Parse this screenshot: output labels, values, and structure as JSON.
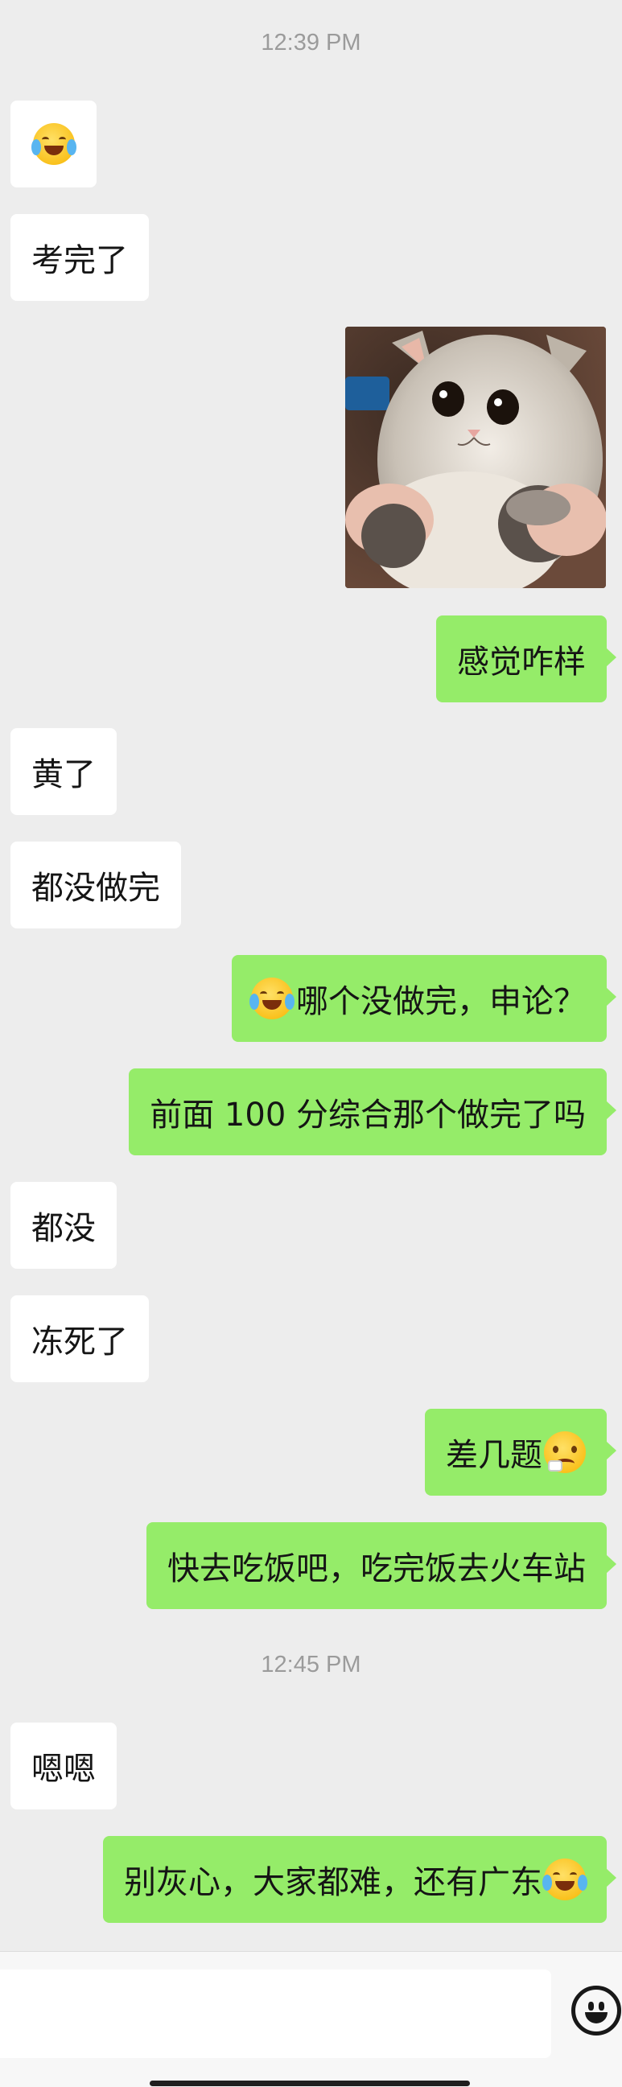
{
  "timestamps": [
    "12:39 PM",
    "12:45 PM"
  ],
  "messages": {
    "m1": "",
    "m2": "考完了",
    "m4": "感觉咋样",
    "m5": "黄了",
    "m6": "都没做完",
    "m7": "哪个没做完，申论？",
    "m8": "前面 100 分综合那个做完了吗",
    "m9": "都没",
    "m10": "冻死了",
    "m11": "差几题",
    "m12": "快去吃饭吧，吃完饭去火车站",
    "m13": "嗯嗯",
    "m14": "别灰心，大家都难，还有广东"
  },
  "image_message": {
    "subject": "kitten photo sticker"
  },
  "colors": {
    "background": "#ededed",
    "self_bubble": "#95ec69",
    "other_bubble": "#ffffff",
    "timestamp": "#9b9b9b"
  },
  "icons": {
    "emoji_button": "smile-icon"
  }
}
